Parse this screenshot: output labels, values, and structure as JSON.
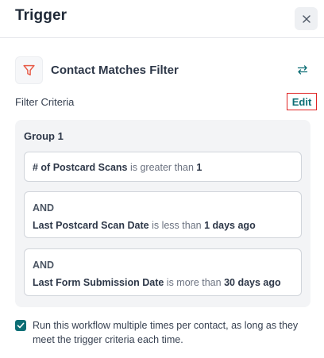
{
  "panel": {
    "title": "Trigger",
    "close_icon": "close-icon"
  },
  "trigger": {
    "icon": "filter-icon",
    "label": "Contact Matches Filter",
    "swap_icon": "swap-arrows-icon"
  },
  "filter_criteria": {
    "label": "Filter Criteria",
    "edit_label": "Edit"
  },
  "group": {
    "title": "Group 1",
    "conditions": [
      {
        "connector": "",
        "field": "# of Postcard Scans",
        "operator": "is greater than",
        "value": "1"
      },
      {
        "connector": "AND",
        "field": "Last Postcard Scan Date",
        "operator": "is less than",
        "value": "1 days ago"
      },
      {
        "connector": "AND",
        "field": "Last Form Submission Date",
        "operator": "is more than",
        "value": "30 days ago"
      }
    ]
  },
  "rerun": {
    "checked": true,
    "label": "Run this workflow multiple times per contact, as long as they meet the trigger criteria each time."
  },
  "colors": {
    "accent": "#0d6e75",
    "filter_icon": "#e85d4a",
    "highlight_border": "#e02424"
  }
}
